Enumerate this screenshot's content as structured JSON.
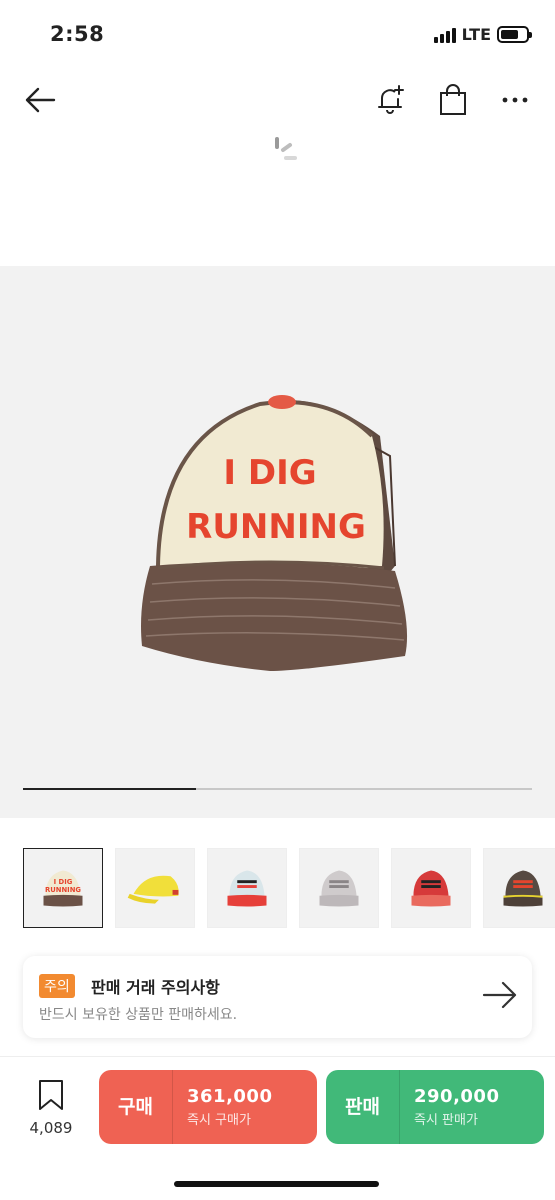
{
  "status": {
    "time": "2:58",
    "network": "LTE"
  },
  "notice": {
    "badge": "주의",
    "title": "판매 거래 주의사항",
    "subtitle": "반드시 보유한 상품만 판매하세요."
  },
  "product": {
    "hero_text_line1": "I DIG",
    "hero_text_line2": "RUNNING",
    "image_progress": 0.34,
    "thumbnail_count": 6
  },
  "bottom": {
    "wish_count": "4,089",
    "buy": {
      "label": "구매",
      "price": "361,000",
      "sublabel": "즉시 구매가"
    },
    "sell": {
      "label": "판매",
      "price": "290,000",
      "sublabel": "즉시 판매가"
    }
  },
  "colors": {
    "buy": "#ef6253",
    "sell": "#41b979",
    "notice_badge": "#f28a30"
  },
  "icons": [
    "back-arrow-icon",
    "bell-plus-icon",
    "shopping-bag-icon",
    "more-icon",
    "loading-spinner-icon",
    "right-arrow-icon",
    "bookmark-icon"
  ]
}
